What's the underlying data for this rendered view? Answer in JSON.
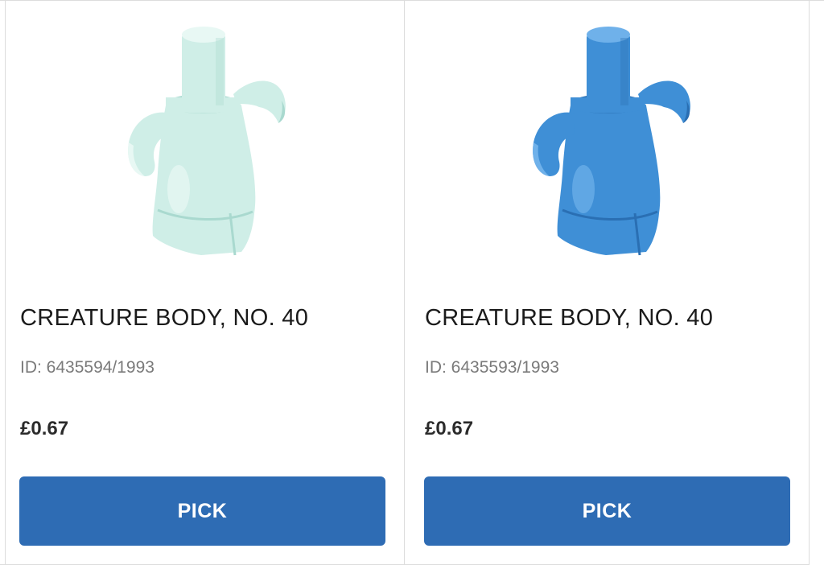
{
  "products": [
    {
      "title": "CREATURE BODY, NO. 40",
      "id_text": "ID: 6435594/1993",
      "price": "£0.67",
      "button_label": "PICK",
      "color_main": "#cfeee7",
      "color_shade": "#a9d9cf",
      "color_light": "#e8f8f4"
    },
    {
      "title": "CREATURE BODY, NO. 40",
      "id_text": "ID: 6435593/1993",
      "price": "£0.67",
      "button_label": "PICK",
      "color_main": "#3f8fd6",
      "color_shade": "#2a6fb3",
      "color_light": "#6fb1ea"
    }
  ],
  "button_color": "#2e6cb4"
}
